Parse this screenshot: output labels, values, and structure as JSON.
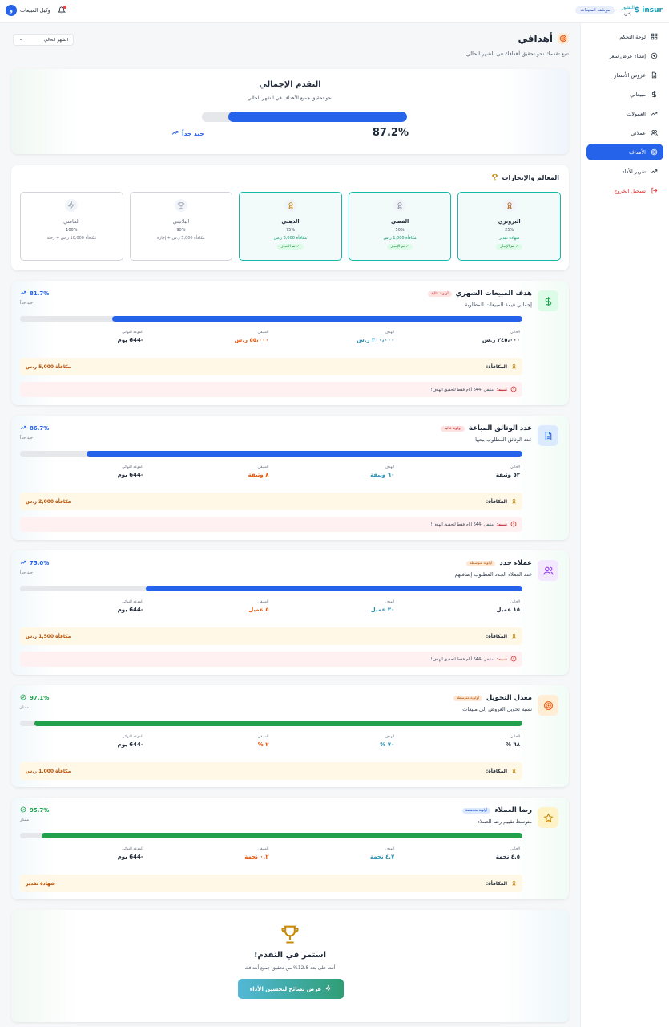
{
  "header": {
    "brand_en": "$ insur",
    "brand_ar_top": "التشور",
    "brand_ar_bottom": "إس",
    "role_badge": "موظف المبيعات",
    "user_name": "وكيل المبيعات",
    "avatar_letter": "و"
  },
  "sidebar": {
    "items": [
      {
        "label": "لوحة التحكم",
        "icon": "grid-icon"
      },
      {
        "label": "إنشاء عرض سعر",
        "icon": "plus-circle-icon"
      },
      {
        "label": "عروض الأسعار",
        "icon": "document-icon"
      },
      {
        "label": "مبيعاتي",
        "icon": "dollar-icon"
      },
      {
        "label": "العمولات",
        "icon": "trend-icon"
      },
      {
        "label": "عملائي",
        "icon": "users-icon"
      },
      {
        "label": "الأهداف",
        "icon": "target-icon",
        "active": true
      },
      {
        "label": "تقرير الأداء",
        "icon": "trend-icon"
      },
      {
        "label": "تسجيل الخروج",
        "icon": "logout-icon"
      }
    ]
  },
  "page": {
    "title": "أهدافي",
    "subtitle": "تتبع تقدمك نحو تحقيق أهدافك في الشهر الحالي",
    "period": "الشهر الحالي"
  },
  "overall": {
    "title": "التقدم الإجمالي",
    "subtitle": "نحو تحقيق جميع الأهداف في الشهر الحالي",
    "percent_label": "87.2%",
    "percent": 87.2,
    "rating": "جيد جداً"
  },
  "milestones": {
    "title": "المعالم والإنجازات",
    "items": [
      {
        "name": "البرونزي",
        "pct": "25%",
        "reward": "شهادة تقدير",
        "done": true,
        "done_label": "تم الإنجاز",
        "color": "#b86a26"
      },
      {
        "name": "الفضي",
        "pct": "50%",
        "reward": "مكافأة 1,000 ر.س",
        "done": true,
        "done_label": "تم الإنجاز",
        "color": "#8b95a3"
      },
      {
        "name": "الذهبي",
        "pct": "75%",
        "reward": "مكافأة 3,000 ر.س",
        "done": true,
        "done_label": "تم الإنجاز",
        "color": "#c08a1a"
      },
      {
        "name": "البلاتيني",
        "pct": "90%",
        "reward": "مكافأة 5,000 ر.س + إجازة",
        "done": false,
        "color": "#9ca3af"
      },
      {
        "name": "الماسي",
        "pct": "100%",
        "reward": "مكافأة 10,000 ر.س + رحلة",
        "done": false,
        "color": "#9ca3af"
      }
    ]
  },
  "goals": [
    {
      "title": "هدف المبيعات الشهري",
      "priority": "أولوية عالية",
      "priority_level": "high",
      "desc": "إجمالي قيمة المبيعات المطلوبة",
      "percent_label": "81.7%",
      "percent": 81.7,
      "rating": "جيد جداً",
      "icon": "dollar-icon",
      "icon_bg": "#dcfce7",
      "icon_color": "#16a34a",
      "bar_color": "#2563eb",
      "pct_color": "#2563eb",
      "trend": true,
      "labels": {
        "current": "الحالي",
        "target": "الهدف",
        "remaining": "المتبقي",
        "deadline": "الموعد النهائي"
      },
      "current": "٢٤٥،٠٠٠ ر.س",
      "target": "٣٠٠،٠٠٠ ر.س",
      "remaining": "٥٥،٠٠٠ ر.س",
      "deadline": "-644 يوم",
      "reward_label": "المكافأة:",
      "reward": "مكافأة 5,000 ر.س",
      "warning_label": "تنبيه:",
      "warning": "متبقي -644 أيام فقط لتحقيق الهدف!"
    },
    {
      "title": "عدد الوثائق المباعة",
      "priority": "أولوية عالية",
      "priority_level": "high",
      "desc": "عدد الوثائق المطلوب بيعها",
      "percent_label": "86.7%",
      "percent": 86.7,
      "rating": "جيد جداً",
      "icon": "document-icon",
      "icon_bg": "#dbeafe",
      "icon_color": "#2563eb",
      "bar_color": "#2563eb",
      "pct_color": "#2563eb",
      "trend": true,
      "labels": {
        "current": "الحالي",
        "target": "الهدف",
        "remaining": "المتبقي",
        "deadline": "الموعد النهائي"
      },
      "current": "٥٢ وثيقة",
      "target": "٦٠ وثيقة",
      "remaining": "٨ وثيقة",
      "deadline": "-644 يوم",
      "reward_label": "المكافأة:",
      "reward": "مكافأة 2,000 ر.س",
      "warning_label": "تنبيه:",
      "warning": "متبقي -644 أيام فقط لتحقيق الهدف!"
    },
    {
      "title": "عملاء جدد",
      "priority": "أولوية متوسطة",
      "priority_level": "mid",
      "desc": "عدد العملاء الجدد المطلوب إضافتهم",
      "percent_label": "75.0%",
      "percent": 75.0,
      "rating": "جيد جداً",
      "icon": "users-icon",
      "icon_bg": "#f3e8ff",
      "icon_color": "#9333ea",
      "bar_color": "#2563eb",
      "pct_color": "#2563eb",
      "trend": true,
      "labels": {
        "current": "الحالي",
        "target": "الهدف",
        "remaining": "المتبقي",
        "deadline": "الموعد النهائي"
      },
      "current": "١٥ عميل",
      "target": "٢٠ عميل",
      "remaining": "٥ عميل",
      "deadline": "-644 يوم",
      "reward_label": "المكافأة:",
      "reward": "مكافأة 1,500 ر.س",
      "warning_label": "تنبيه:",
      "warning": "متبقي -644 أيام فقط لتحقيق الهدف!"
    },
    {
      "title": "معدل التحويل",
      "priority": "أولوية متوسطة",
      "priority_level": "mid",
      "desc": "نسبة تحويل العروض إلى مبيعات",
      "percent_label": "97.1%",
      "percent": 97.1,
      "rating": "ممتاز",
      "icon": "target-icon",
      "icon_bg": "#ffedd5",
      "icon_color": "#ea580c",
      "bar_color": "#22a04b",
      "pct_color": "#16a34a",
      "trend": false,
      "labels": {
        "current": "الحالي",
        "target": "الهدف",
        "remaining": "المتبقي",
        "deadline": "الموعد النهائي"
      },
      "current": "٦٨ %",
      "target": "٧٠ %",
      "remaining": "٢ %",
      "deadline": "-644 يوم",
      "reward_label": "المكافأة:",
      "reward": "مكافأة 1,000 ر.س"
    },
    {
      "title": "رضا العملاء",
      "priority": "أولوية منخفضة",
      "priority_level": "low",
      "desc": "متوسط تقييم رضا العملاء",
      "percent_label": "95.7%",
      "percent": 95.7,
      "rating": "ممتاز",
      "icon": "star-icon",
      "icon_bg": "#fef3c7",
      "icon_color": "#ca8a04",
      "bar_color": "#22a04b",
      "pct_color": "#16a34a",
      "trend": false,
      "labels": {
        "current": "الحالي",
        "target": "الهدف",
        "remaining": "المتبقي",
        "deadline": "الموعد النهائي"
      },
      "current": "٤.٥ نجمة",
      "target": "٤.٧ نجمة",
      "remaining": "٠.٢ نجمة",
      "deadline": "-644 يوم",
      "reward_label": "المكافأة:",
      "reward": "شهادة تقدير"
    }
  ],
  "footer": {
    "title": "استمر في التقدم!",
    "subtitle": "أنت على بعد 12.8% من تحقيق جميع أهدافك",
    "button": "عرض نصائح لتحسين الأداء"
  }
}
